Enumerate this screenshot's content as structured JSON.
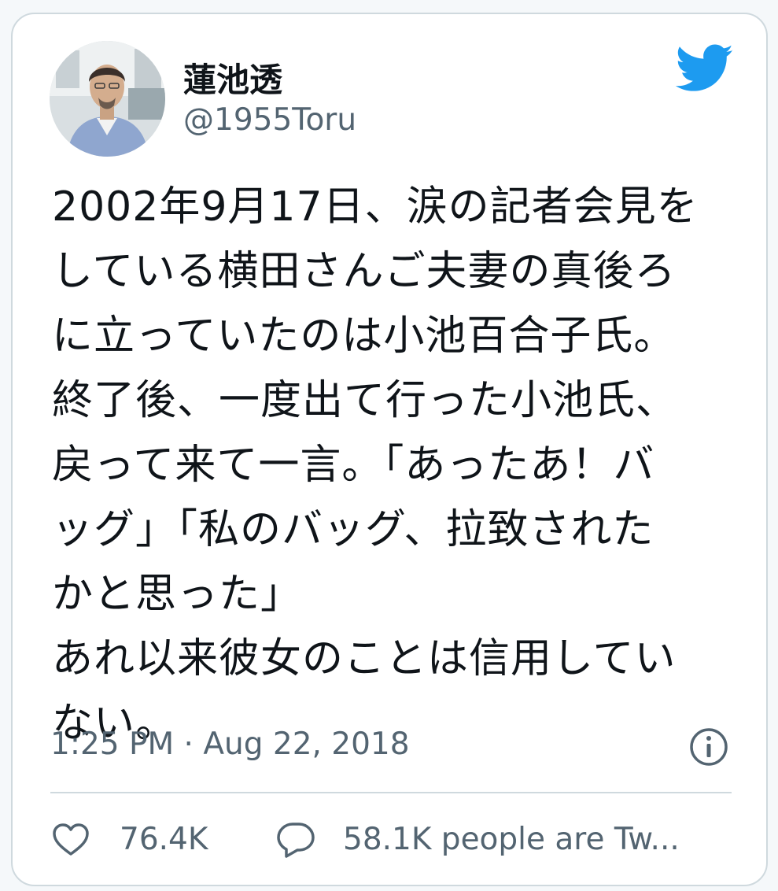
{
  "user": {
    "display_name": "蓮池透",
    "handle": "@1955Toru"
  },
  "tweet": {
    "text": "2002年9月17日、涙の記者会見をしている横田さんご夫妻の真後ろに立っていたのは小池百合子氏。終了後、一度出て行った小池氏、戻って来て一言。「あったあ！バッグ」「私のバッグ、拉致されたかと思った」\nあれ以来彼女のことは信用していない。",
    "lines": [
      "2002年9月17日、涙の記者会見を",
      "している横田さんご夫妻の真後ろ",
      "に立っていたのは小池百合子氏。",
      "終了後、一度出て行った小池氏、",
      "戻って来て一言。「あったあ！バ",
      "ッグ」「私のバッグ、拉致された",
      "かと思った」",
      "あれ以来彼女のことは信用してい",
      "ない。"
    ],
    "timestamp": "1:25 PM · Aug 22, 2018"
  },
  "actions": {
    "like_count": "76.4K",
    "reply_text": "58.1K people are Tw..."
  },
  "icons": {
    "brand": "twitter-bird-icon",
    "info": "info-icon",
    "like": "heart-icon",
    "reply": "speech-bubble-icon"
  },
  "colors": {
    "brand_blue": "#1d9bf0",
    "text_primary": "#0f1419",
    "text_secondary": "#536471",
    "border": "#cfd9de"
  }
}
